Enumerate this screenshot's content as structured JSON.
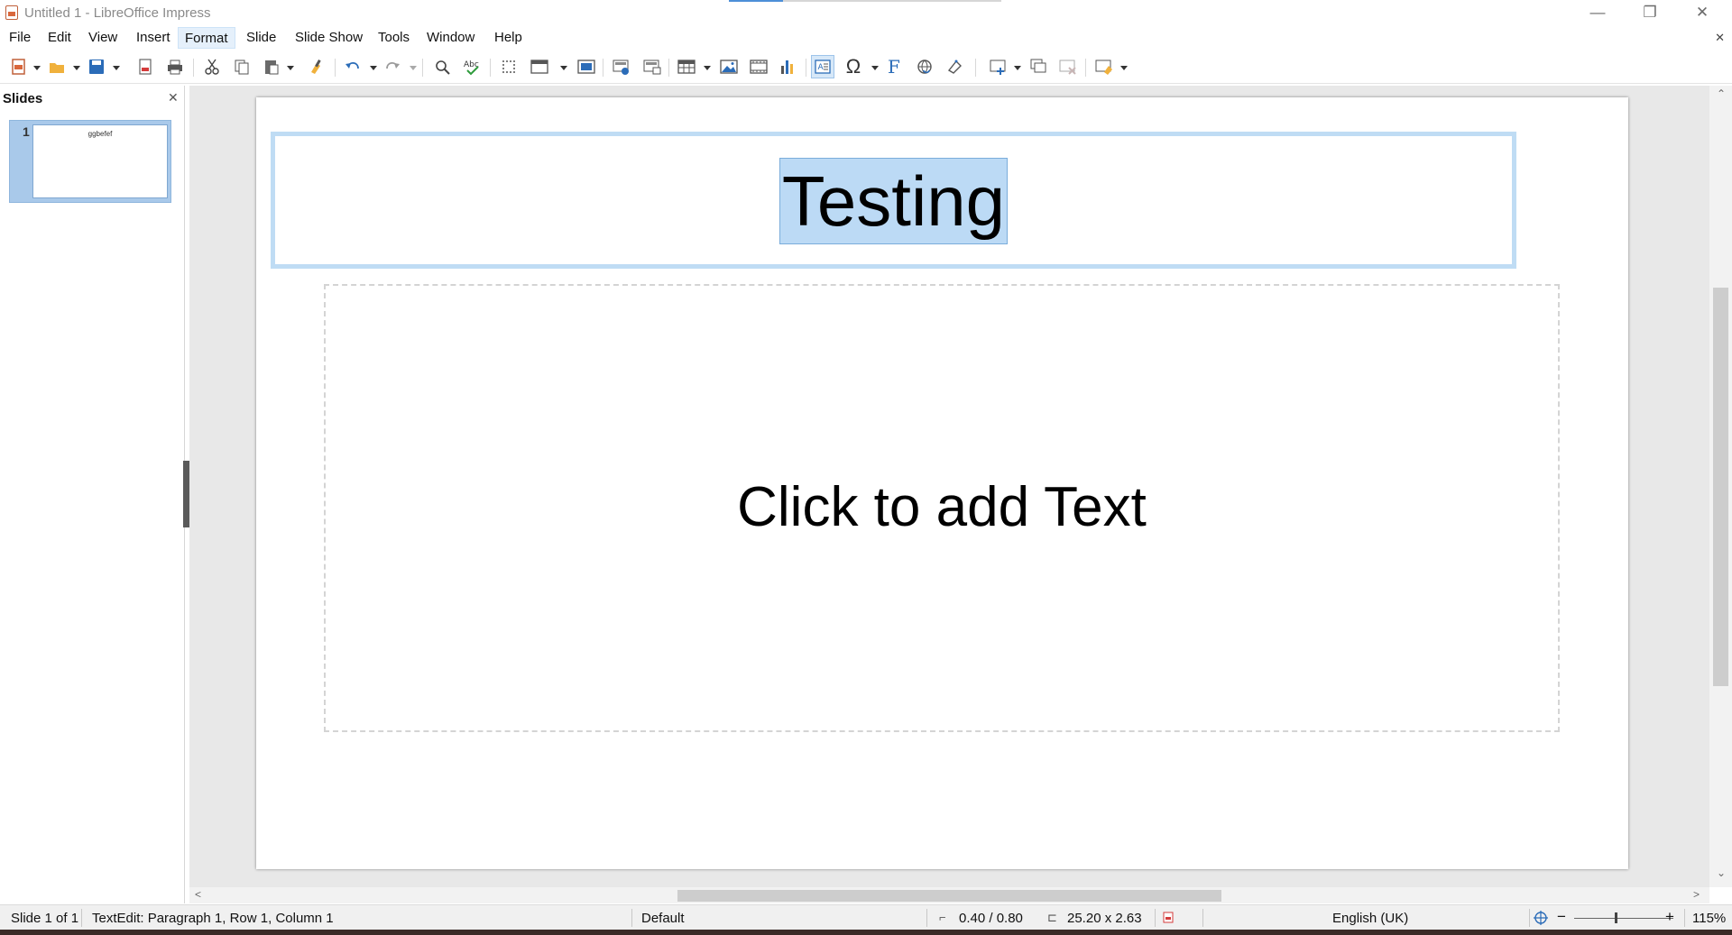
{
  "window": {
    "title": "Untitled 1 - LibreOffice Impress",
    "minimize": "—",
    "restore": "❐",
    "close": "✕",
    "doc_close": "✕"
  },
  "menu": {
    "items": [
      "File",
      "Edit",
      "View",
      "Insert",
      "Format",
      "Slide",
      "Slide Show",
      "Tools",
      "Window",
      "Help"
    ],
    "active": "Format"
  },
  "toolbar": {
    "icons": [
      "new-icon",
      "open-icon",
      "save-icon",
      "export-pdf-icon",
      "print-icon",
      "cut-icon",
      "copy-icon",
      "paste-icon",
      "clone-formatting-icon",
      "undo-icon",
      "redo-icon",
      "find-replace-icon",
      "spelling-icon",
      "grid-icon",
      "display-views-icon",
      "master-slide-icon",
      "start-first-slide-icon",
      "start-current-slide-icon",
      "table-icon",
      "image-icon",
      "media-icon",
      "chart-icon",
      "text-box-icon",
      "special-character-icon",
      "fontwork-icon",
      "hyperlink-icon",
      "transformations-icon",
      "new-slide-icon",
      "duplicate-slide-icon",
      "delete-slide-icon",
      "slide-layout-icon"
    ],
    "pressed": "text-box-icon",
    "special_char_glyph": "Ω",
    "fontwork_glyph": "F"
  },
  "slide_pane": {
    "title": "Slides",
    "close": "✕",
    "slides": [
      {
        "number": "1",
        "thumb_text": "ggbefef"
      }
    ]
  },
  "slide": {
    "title_text": "Testing",
    "content_placeholder": "Click to add Text"
  },
  "scroll": {
    "up": "⌃",
    "down": "⌄",
    "left": "<",
    "right": ">"
  },
  "status": {
    "slide": "Slide 1 of 1",
    "edit_mode": "TextEdit: Paragraph 1, Row 1, Column 1",
    "master": "Default",
    "position": "0.40 / 0.80",
    "size": "25.20 x 2.63",
    "language": "English (UK)",
    "zoom_minus": "−",
    "zoom_plus": "+",
    "zoom": "115%"
  },
  "colors": {
    "selection": "#bcdaf5",
    "frame": "#bfdcf4",
    "accent_blue": "#2b6cb8"
  }
}
